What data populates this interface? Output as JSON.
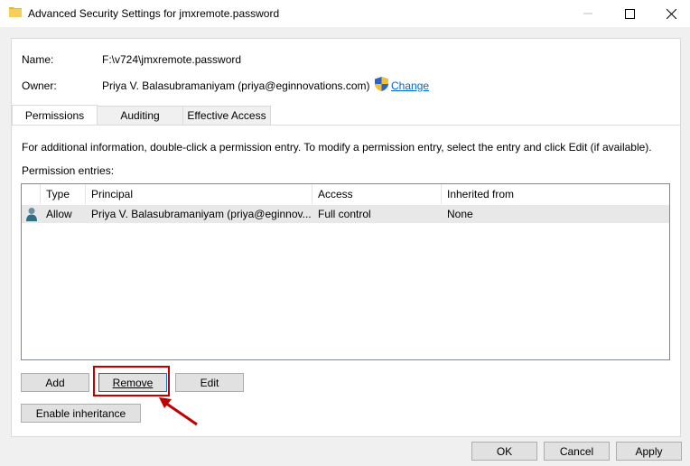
{
  "window": {
    "title": "Advanced Security Settings for jmxremote.password"
  },
  "fields": {
    "name_label": "Name:",
    "name_value": "F:\\v724\\jmxremote.password",
    "owner_label": "Owner:",
    "owner_value": "Priya V. Balasubramaniyam (priya@eginnovations.com)",
    "change_link": "Change"
  },
  "tabs": [
    {
      "label": "Permissions"
    },
    {
      "label": "Auditing"
    },
    {
      "label": "Effective Access"
    }
  ],
  "info_text": "For additional information, double-click a permission entry. To modify a permission entry, select the entry and click Edit (if available).",
  "entries_label": "Permission entries:",
  "table": {
    "columns": [
      "Type",
      "Principal",
      "Access",
      "Inherited from"
    ],
    "rows": [
      {
        "type": "Allow",
        "principal": "Priya V. Balasubramaniyam (priya@eginnov...",
        "access": "Full control",
        "inherited": "None"
      }
    ]
  },
  "buttons": {
    "add": "Add",
    "remove": "Remove",
    "edit": "Edit",
    "enable_inheritance": "Enable inheritance",
    "ok": "OK",
    "cancel": "Cancel",
    "apply": "Apply"
  },
  "colors": {
    "link": "#0066cc",
    "highlight": "#c00000"
  }
}
